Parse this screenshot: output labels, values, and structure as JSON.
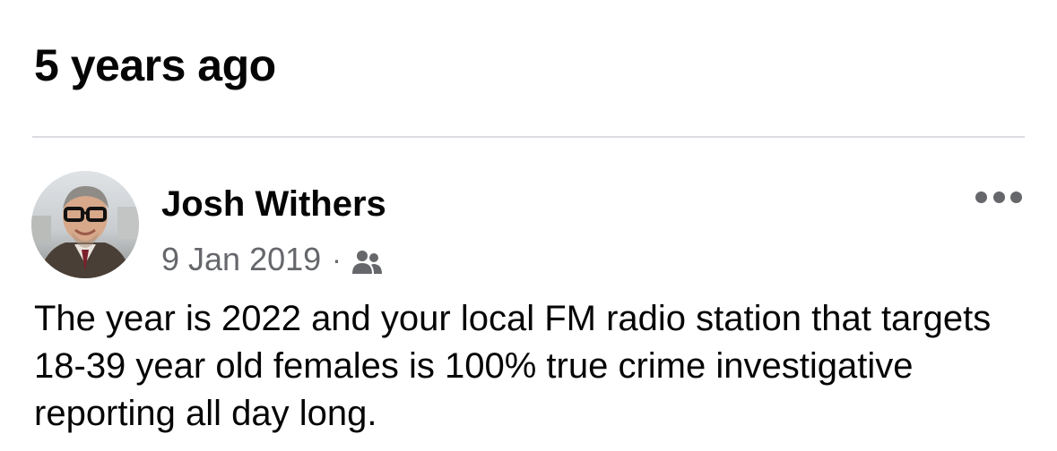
{
  "memories": {
    "section_title": "5 years ago"
  },
  "post": {
    "author_name": "Josh Withers",
    "date": "9 Jan 2019",
    "separator": "·",
    "audience_icon": "friends-icon",
    "more_icon": "more-options-icon",
    "text": "The year is 2022 and your local FM radio station that targets 18-39 year old females is 100% true crime investigative reporting all day long."
  },
  "colors": {
    "primary_text": "#050505",
    "secondary_text": "#65676b",
    "divider": "#dcdde1",
    "background": "#ffffff"
  }
}
